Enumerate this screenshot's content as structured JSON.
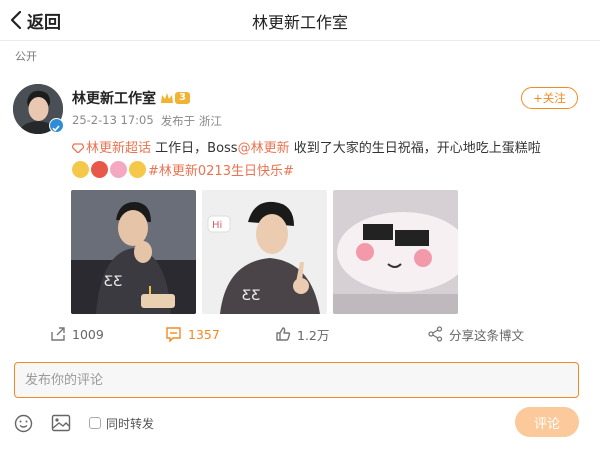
{
  "header": {
    "back_label": "返回",
    "title": "林更新工作室"
  },
  "post": {
    "visibility": "公开",
    "author": {
      "name": "林更新工作室",
      "vip_level": "3"
    },
    "date": "25-2-13 17:05",
    "source": "发布于 浙江",
    "follow_label": "+关注",
    "text": {
      "supertopic": "林更新超话",
      "part1": " 工作日，Boss",
      "mention": "@林更新",
      "part2": " 收到了大家的生日祝福，开心地吃上蛋糕啦",
      "hashtag": "#林更新0213生日快乐#"
    },
    "photos": [
      "photo-1",
      "photo-2",
      "photo-3"
    ],
    "stats": {
      "reposts": "1009",
      "comments": "1357",
      "likes": "1.2万",
      "share_label": "分享这条博文"
    }
  },
  "comment": {
    "placeholder": "发布你的评论",
    "repost_label": "同时转发",
    "submit_label": "评论"
  },
  "colors": {
    "accent": "#f28a24",
    "link": "#eb7350",
    "submit_bg": "#fbc99a",
    "verified": "#2f8dd8"
  }
}
